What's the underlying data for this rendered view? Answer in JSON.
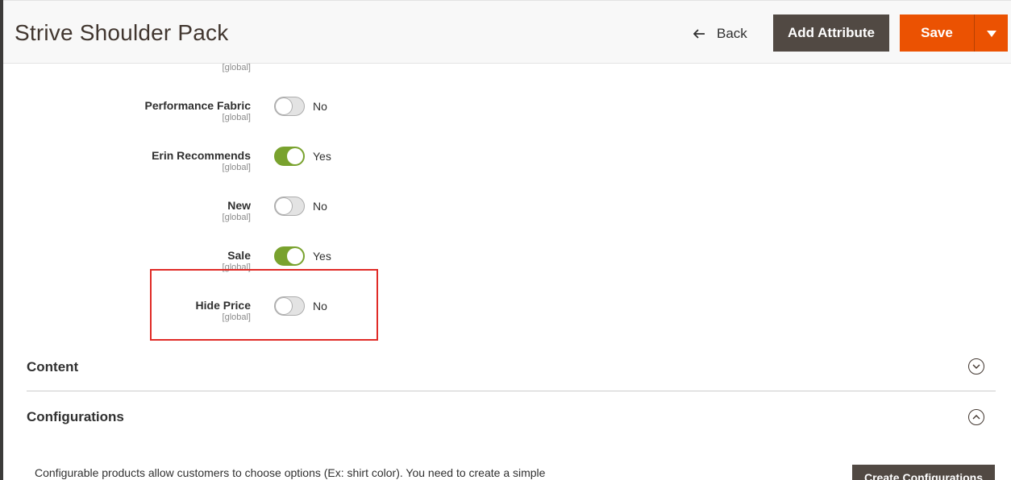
{
  "header": {
    "title": "Strive Shoulder Pack",
    "back_label": "Back",
    "add_attribute_label": "Add Attribute",
    "save_label": "Save"
  },
  "attributes": [
    {
      "label": "",
      "scope": "[global]",
      "value": "",
      "on": false
    },
    {
      "label": "Performance Fabric",
      "scope": "[global]",
      "value": "No",
      "on": false
    },
    {
      "label": "Erin Recommends",
      "scope": "[global]",
      "value": "Yes",
      "on": true
    },
    {
      "label": "New",
      "scope": "[global]",
      "value": "No",
      "on": false
    },
    {
      "label": "Sale",
      "scope": "[global]",
      "value": "Yes",
      "on": true
    },
    {
      "label": "Hide Price",
      "scope": "[global]",
      "value": "No",
      "on": false
    }
  ],
  "sections": {
    "content": {
      "title": "Content"
    },
    "configurations": {
      "title": "Configurations",
      "description": "Configurable products allow customers to choose options (Ex: shirt color). You need to create a simple",
      "create_button": "Create Configurations"
    }
  },
  "colors": {
    "accent_orange": "#eb5202",
    "dark_button": "#514943",
    "toggle_on": "#79a22e",
    "highlight_red": "#e02b27"
  }
}
